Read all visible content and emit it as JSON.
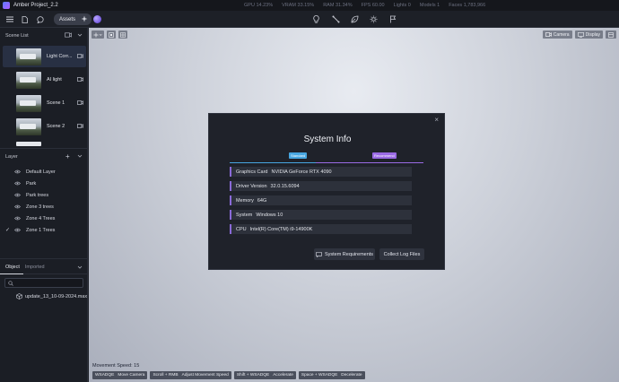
{
  "app": {
    "title": "Amber Project_2.2"
  },
  "stats": [
    "GPU 14.23%",
    "VRAM 33.15%",
    "RAM 31.34%",
    "FPS 60.00",
    "Lights 0",
    "Models 1",
    "Faces 1,783,966"
  ],
  "toolbar": {
    "assets_label": "Assets"
  },
  "scene_list": {
    "header": "Scene List",
    "items": [
      {
        "label": "Light Corr...",
        "active": true
      },
      {
        "label": "AI light",
        "active": false
      },
      {
        "label": "Scene 1",
        "active": false
      },
      {
        "label": "Scene 2",
        "active": false
      }
    ]
  },
  "layer": {
    "header": "Layer",
    "items": [
      {
        "label": "Default Layer",
        "checked": false
      },
      {
        "label": "Park",
        "checked": false
      },
      {
        "label": "Park trees",
        "checked": false
      },
      {
        "label": "Zone 3 trees",
        "checked": false
      },
      {
        "label": "Zone 4 Trees",
        "checked": false
      },
      {
        "label": "Zone 1 Trees",
        "checked": true
      }
    ]
  },
  "object_panel": {
    "tabs": [
      {
        "label": "Object",
        "active": true
      },
      {
        "label": "Imported",
        "active": false
      }
    ],
    "search_placeholder": "",
    "files": [
      {
        "name": "update_13_10-09-2024.max"
      }
    ]
  },
  "viewport": {
    "camera_label": "Camera",
    "display_label": "Display",
    "movement_speed": "Movement Speed: 15",
    "hints": [
      {
        "keys": "WSADQE",
        "action": "Move Camera"
      },
      {
        "keys": "Scroll + RMB",
        "action": "Adjust Movement Speed"
      },
      {
        "keys": "Shift + WSADQE",
        "action": "Accelerate"
      },
      {
        "keys": "Space + WSADQE",
        "action": "Decelerate"
      }
    ]
  },
  "modal": {
    "title": "System Info",
    "tag_standard": "Standard",
    "tag_recommended": "Recommend",
    "rows": [
      {
        "label": "Graphics Card",
        "value": "NVIDIA GeForce RTX 4090"
      },
      {
        "label": "Driver Version",
        "value": "32.0.15.6094"
      },
      {
        "label": "Memory",
        "value": "64G"
      },
      {
        "label": "System",
        "value": "Windows 10"
      },
      {
        "label": "CPU",
        "value": "Intel(R) Core(TM) i9-14900K"
      }
    ],
    "btn_requirements": "System Requirements",
    "btn_logs": "Collect Log Files"
  },
  "colors": {
    "accent_blue": "#47a6e0",
    "accent_purple": "#9a6ae4",
    "panel": "#1b1e25"
  }
}
